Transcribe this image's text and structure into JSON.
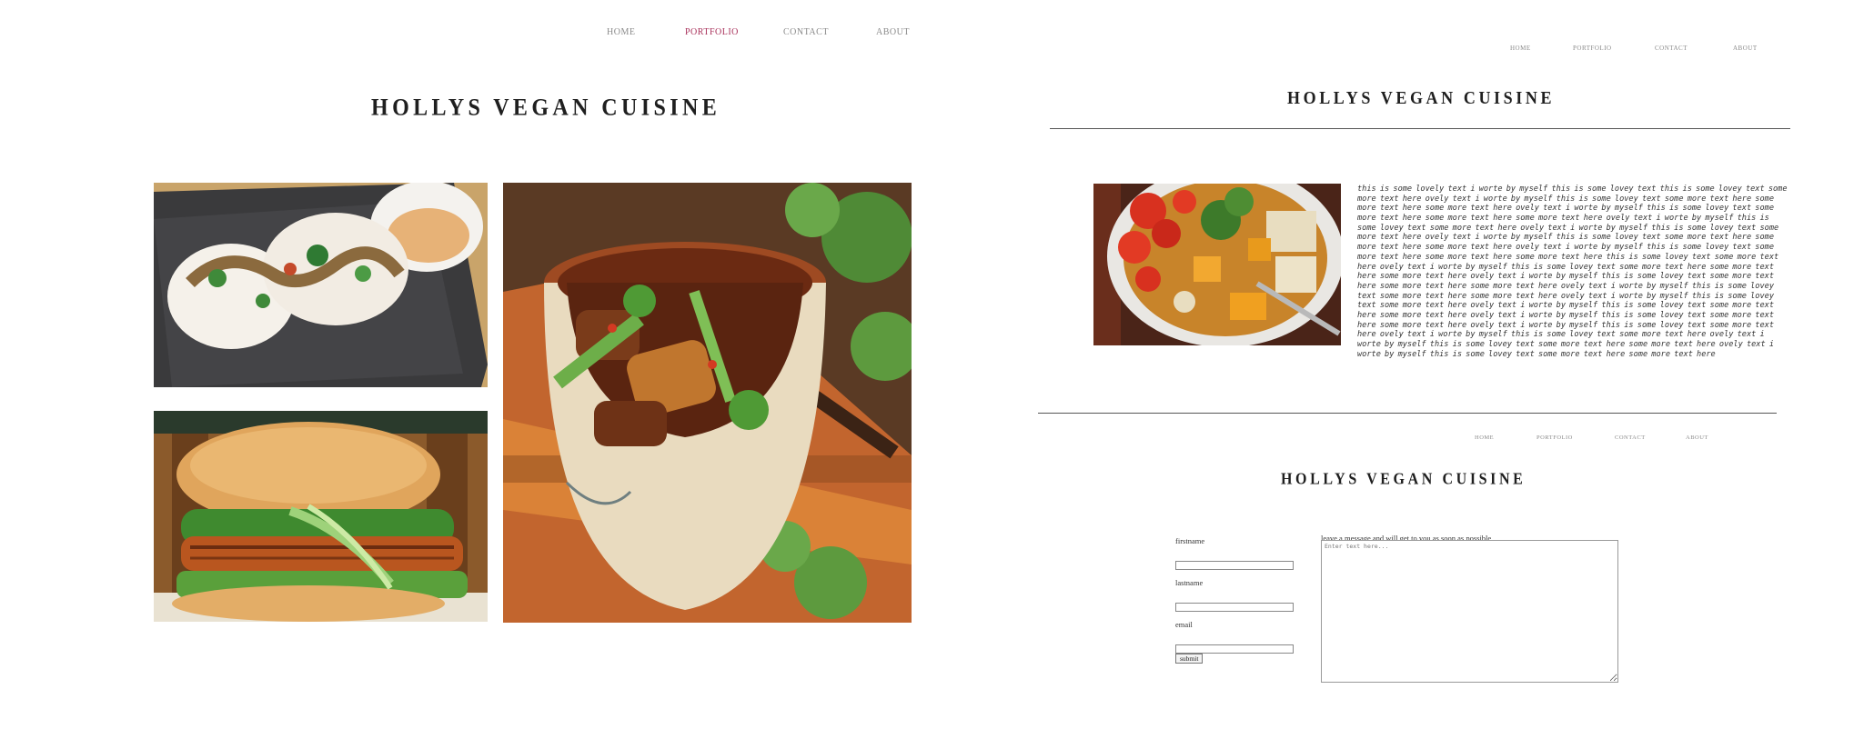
{
  "page1": {
    "nav": [
      "HOME",
      "PORTFOLIO",
      "CONTACT",
      "ABOUT"
    ],
    "active_nav": "PORTFOLIO",
    "title": "HOLLYS VEGAN CUISINE",
    "photos": [
      "bao-buns-photo",
      "vegan-burger-photo",
      "braised-eggplant-bowl-photo"
    ]
  },
  "page2": {
    "nav": [
      "HOME",
      "PORTFOLIO",
      "CONTACT",
      "ABOUT"
    ],
    "title": "HOLLYS VEGAN CUISINE",
    "photo": "vegetable-soup-photo",
    "text": "this is some lovely text i worte by myself this is some lovey text this is some lovey text some more text here ovely text i worte by myself this is some lovey text some more text here some more text here some more text here ovely text i worte by myself this is some lovey text some more text here some more text here some more text here ovely text i worte by myself this is some lovey text some more text here ovely text i worte by myself this is some lovey text some more text here ovely text i worte by myself this is some lovey text some more text here some more text here some more text here ovely text i worte by myself this is some lovey text some more text here some more text here some more text here this is some lovey text some more text here ovely text i worte by myself this is some lovey text some more text here some more text here some more text here ovely text i worte by myself this is some lovey text some more text here some more text here some more text here ovely text i worte by myself this is some lovey text some more text here some more text here ovely text i worte by myself this is some lovey text some more text here ovely text i worte by myself this is some lovey text some more text here some more text here ovely text i worte by myself this is some lovey text some more text here some more text here ovely text i worte by myself this is some lovey text some more text here ovely text i worte by myself this is some lovey text some more text here ovely text i worte by myself this is some lovey text some more text here some more text here ovely text i worte by myself this is some lovey text some more text here some more text here"
  },
  "page3": {
    "nav": [
      "HOME",
      "PORTFOLIO",
      "CONTACT",
      "ABOUT"
    ],
    "title": "HOLLYS VEGAN CUISINE",
    "form": {
      "firstname_label": "firstname",
      "lastname_label": "lastname",
      "email_label": "email",
      "submit_label": "submit",
      "message_label": "leave a message and will get to you as soon as possible",
      "message_placeholder": "Enter text here..."
    }
  },
  "colors": {
    "active_nav": "#a8305a",
    "nav": "#8a8a8a",
    "title": "#1f1f1f"
  }
}
